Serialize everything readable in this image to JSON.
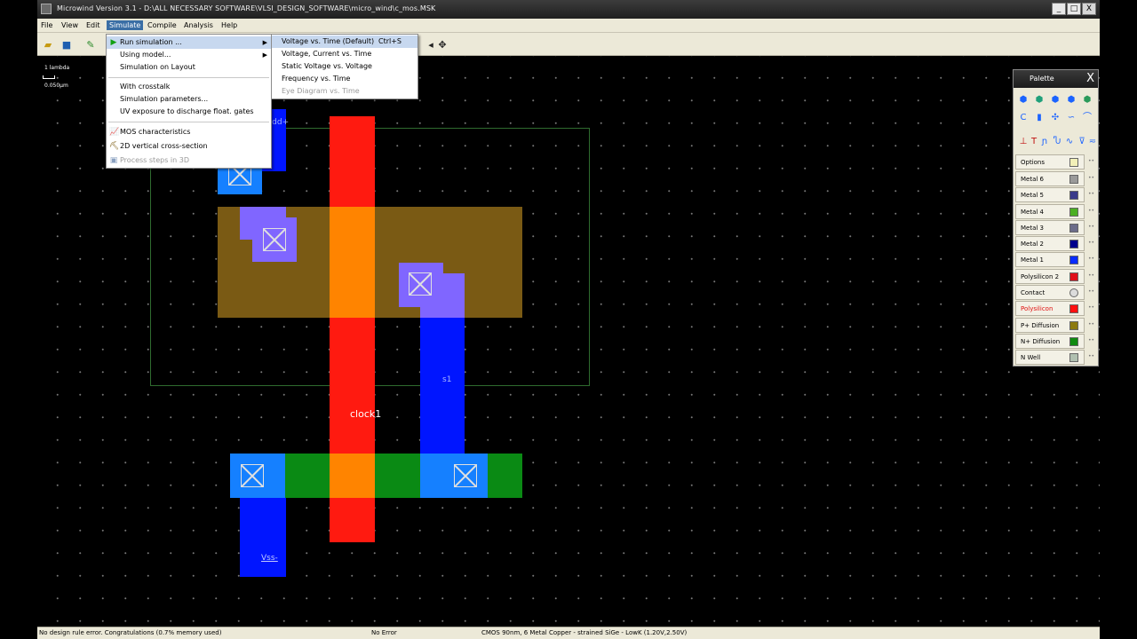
{
  "window": {
    "title": "Microwind Version 3.1 - D:\\ALL NECESSARY SOFTWARE\\VLSI_DESIGN_SOFTWARE\\micro_wind\\c_mos.MSK",
    "btn_min": "_",
    "btn_max": "□",
    "btn_close": "X"
  },
  "menubar": [
    "File",
    "View",
    "Edit",
    "Simulate",
    "Compile",
    "Analysis",
    "Help"
  ],
  "canvas": {
    "scale_top": "1 lambda",
    "scale_bottom": "0.050µm",
    "labels": {
      "vdd": "Vdd+",
      "s1": "s1",
      "clock": "clock1",
      "vss": "Vss-"
    }
  },
  "simulate_menu": {
    "items": [
      {
        "label": "Run simulation ...",
        "submenu": "▶",
        "icon": "▶"
      },
      {
        "label": "Using model...",
        "submenu": "▶"
      },
      {
        "label": "Simulation on Layout"
      },
      {
        "label": "With crosstalk"
      },
      {
        "label": "Simulation parameters..."
      },
      {
        "label": "UV exposure to discharge float. gates"
      },
      {
        "label": "MOS characteristics",
        "icon": "📈"
      },
      {
        "label": "2D vertical cross-section",
        "icon": "⛏"
      },
      {
        "label": "Process steps in 3D",
        "icon": "▣"
      }
    ]
  },
  "run_submenu": {
    "items": [
      {
        "label": "Voltage vs. Time (Default)",
        "shortcut": "Ctrl+S"
      },
      {
        "label": "Voltage, Current vs. Time"
      },
      {
        "label": "Static Voltage vs. Voltage"
      },
      {
        "label": "Frequency vs. Time"
      },
      {
        "label": "Eye Diagram vs. Time"
      }
    ]
  },
  "palette": {
    "title": "Palette",
    "close": "X",
    "layers": [
      {
        "name": "Options",
        "color": "#f2f0b8"
      },
      {
        "name": "Metal 6",
        "color": "#9a9a9a"
      },
      {
        "name": "Metal 5",
        "color": "#3a3a8a"
      },
      {
        "name": "Metal 4",
        "color": "#4caf22"
      },
      {
        "name": "Metal 3",
        "color": "#6d6d8a"
      },
      {
        "name": "Metal 2",
        "color": "#00008c"
      },
      {
        "name": "Metal 1",
        "color": "#0a2cff"
      },
      {
        "name": "Polysilicon 2",
        "color": "#e0101a"
      },
      {
        "name": "Contact",
        "color": "#dcdcdc"
      },
      {
        "name": "Polysilicon",
        "color": "#ff1010"
      },
      {
        "name": "P+ Diffusion",
        "color": "#8c7a10"
      },
      {
        "name": "N+ Diffusion",
        "color": "#108a10"
      },
      {
        "name": "N Well",
        "color": "#b0c0b0"
      }
    ]
  },
  "statusbar": {
    "drc": "No design rule error. Congratulations (0.7% memory used)",
    "error": "No Error",
    "tech": "CMOS 90nm, 6 Metal Copper - strained SiGe - LowK (1.20V,2.50V)"
  }
}
